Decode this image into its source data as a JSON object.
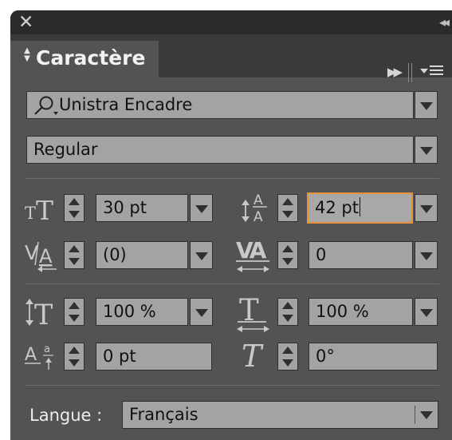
{
  "panel": {
    "close_glyph": "✕",
    "collapse_glyph": "◂◂",
    "tab": {
      "label": "Caractère",
      "arrows_up": "▲",
      "arrows_down": "▼"
    },
    "fast_forward_glyph": "▶▶"
  },
  "font": {
    "family_value": "Unistra Encadre",
    "style_value": "Regular"
  },
  "metrics": {
    "size_value": "30 pt",
    "leading_value": "42 pt",
    "kerning_value": "(0)",
    "tracking_value": "0",
    "vertical_scale_value": "100 %",
    "horizontal_scale_value": "100 %",
    "baseline_shift_value": "0 pt",
    "skew_value": "0°"
  },
  "language": {
    "label": "Langue :",
    "value": "Français"
  },
  "icons": [
    "close-icon",
    "collapse-panel-icon",
    "tab-arrows-icon",
    "fast-forward-icon",
    "panel-menu-icon",
    "search-icon",
    "dropdown-arrow-icon",
    "spinner-icon",
    "font-size-icon",
    "leading-icon",
    "kerning-icon",
    "tracking-icon",
    "vertical-scale-icon",
    "horizontal-scale-icon",
    "baseline-shift-icon",
    "skew-icon"
  ],
  "colors": {
    "panel_bg": "#535353",
    "titlebar_bg": "#2b2b2b",
    "field_bg": "#a3a3a3",
    "focus_border": "#e8913a"
  }
}
